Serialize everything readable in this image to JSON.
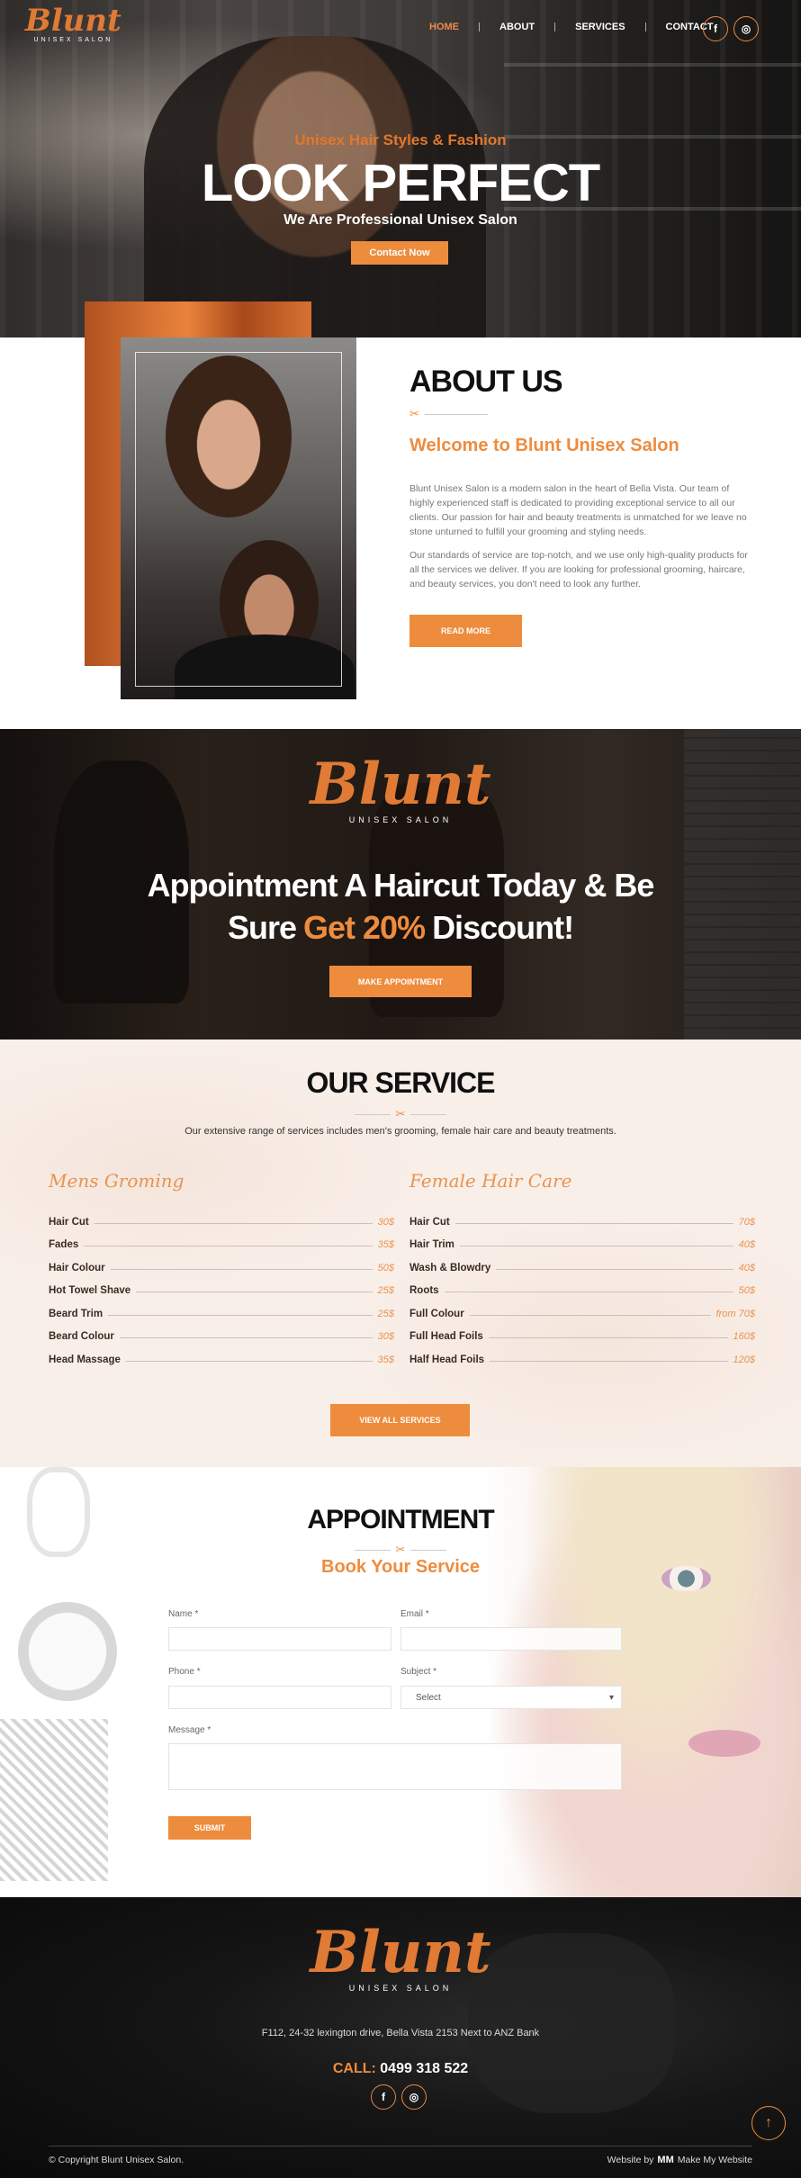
{
  "brand": {
    "logo_script": "Blunt",
    "logo_sub": "UNISEX SALON",
    "accent": "#ee8c3e"
  },
  "nav": {
    "items": [
      "HOME",
      "ABOUT",
      "SERVICES",
      "CONTACT"
    ]
  },
  "social": {
    "facebook_icon": "f",
    "instagram_icon": "◎"
  },
  "hero": {
    "kicker": "Unisex Hair Styles & Fashion",
    "title": "LOOK PERFECT",
    "tagline": "We Are Professional Unisex Salon",
    "cta": "Contact Now"
  },
  "about": {
    "title": "ABOUT US",
    "subtitle": "Welcome to Blunt Unisex Salon",
    "para1": "Blunt Unisex Salon is a modern salon in the heart of Bella Vista. Our team of highly experienced staff is dedicated to providing exceptional service to all our clients. Our passion for hair and beauty treatments is unmatched for we leave no stone unturned to fulfill your grooming and styling needs.",
    "para2": "Our standards of service are top-notch, and we use only high-quality products for all the services we deliver. If you are looking for professional grooming, haircare, and beauty services, you don't need to look any further.",
    "button": "READ MORE"
  },
  "promo": {
    "line1": "Appointment A Haircut Today & Be",
    "line2_a": "Sure",
    "line2_hl": "Get 20%",
    "line2_b": "Discount!",
    "button": "MAKE APPOINTMENT"
  },
  "services": {
    "title": "OUR SERVICE",
    "intro": "Our extensive range of services includes men's grooming, female hair care and beauty treatments.",
    "mens": {
      "heading": "Mens Groming",
      "items": [
        {
          "name": "Hair Cut",
          "price": "30$"
        },
        {
          "name": "Fades",
          "price": "35$"
        },
        {
          "name": "Hair Colour",
          "price": "50$"
        },
        {
          "name": "Hot Towel Shave",
          "price": "25$"
        },
        {
          "name": "Beard Trim",
          "price": "25$"
        },
        {
          "name": "Beard Colour",
          "price": "30$"
        },
        {
          "name": "Head Massage",
          "price": "35$"
        }
      ]
    },
    "female": {
      "heading": "Female Hair Care",
      "items": [
        {
          "name": "Hair Cut",
          "price": "70$"
        },
        {
          "name": "Hair Trim",
          "price": "40$"
        },
        {
          "name": "Wash & Blowdry",
          "price": "40$"
        },
        {
          "name": "Roots",
          "price": "50$"
        },
        {
          "name": "Full Colour",
          "price": "from 70$"
        },
        {
          "name": "Full Head Foils",
          "price": "160$"
        },
        {
          "name": "Half Head Foils",
          "price": "120$"
        }
      ]
    },
    "button": "VIEW ALL SERVICES"
  },
  "appointment": {
    "title": "APPOINTMENT",
    "subtitle": "Book Your Service",
    "form": {
      "name_label": "Name *",
      "email_label": "Email *",
      "phone_label": "Phone *",
      "subject_label": "Subject *",
      "subject_value": "Select",
      "message_label": "Message *",
      "submit": "SUBMIT"
    }
  },
  "footer": {
    "address": "F112, 24-32 lexington drive, Bella Vista 2153 Next to ANZ Bank",
    "call_label": "CALL:",
    "phone": "0499 318 522",
    "copyright": "© Copyright Blunt Unisex Salon.",
    "credit_prefix": "Website by",
    "credit_mark": "MM",
    "credit_name": "Make My Website",
    "back_to_top_icon": "↑"
  }
}
